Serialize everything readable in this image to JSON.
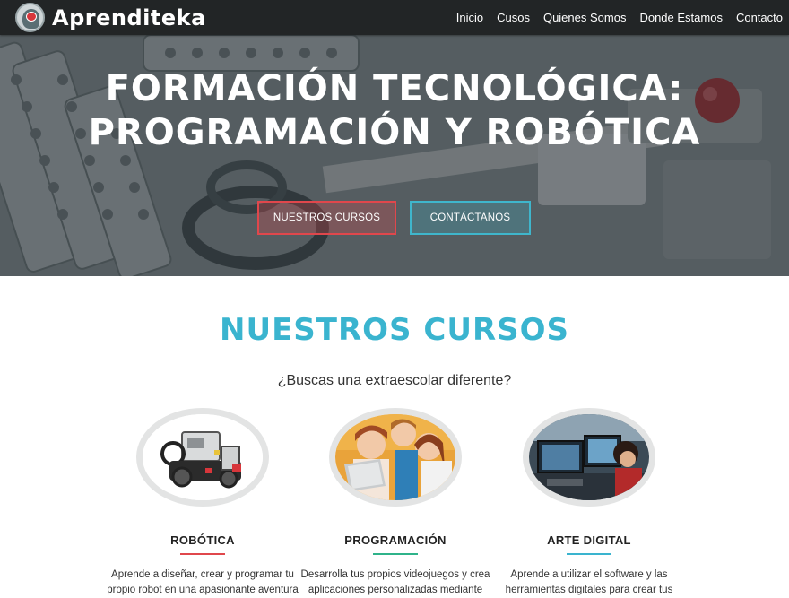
{
  "brand": {
    "name": "Aprenditeka",
    "icon": "brain-head-logo-icon"
  },
  "nav": {
    "items": [
      {
        "label": "Inicio"
      },
      {
        "label": "Cusos"
      },
      {
        "label": "Quienes Somos"
      },
      {
        "label": "Donde Estamos"
      },
      {
        "label": "Contacto"
      }
    ]
  },
  "hero": {
    "title_line1": "FORMACIÓN TECNOLÓGICA:",
    "title_line2": "PROGRAMACIÓN Y ROBÓTICA",
    "button_courses": "NUESTROS CURSOS",
    "button_contact": "CONTÁCTANOS"
  },
  "courses": {
    "heading": "NUESTROS CURSOS",
    "subheading": "¿Buscas una extraescolar diferente?",
    "items": [
      {
        "title": "ROBÓTICA",
        "accent": "#e0474c",
        "description": "Aprende a diseñar, crear y programar tu propio robot en una apasionante aventura"
      },
      {
        "title": "PROGRAMACIÓN",
        "accent": "#2fb38a",
        "description": "Desarrolla tus propios videojuegos y crea aplicaciones personalizadas mediante"
      },
      {
        "title": "ARTE DIGITAL",
        "accent": "#3ab4cf",
        "description": "Aprende a utilizar el software y las herramientas digitales para crear tus"
      }
    ]
  },
  "colors": {
    "navbar": "#222526",
    "heading": "#3ab4cf",
    "red": "#e0474c",
    "cyan": "#3fb6cc"
  }
}
